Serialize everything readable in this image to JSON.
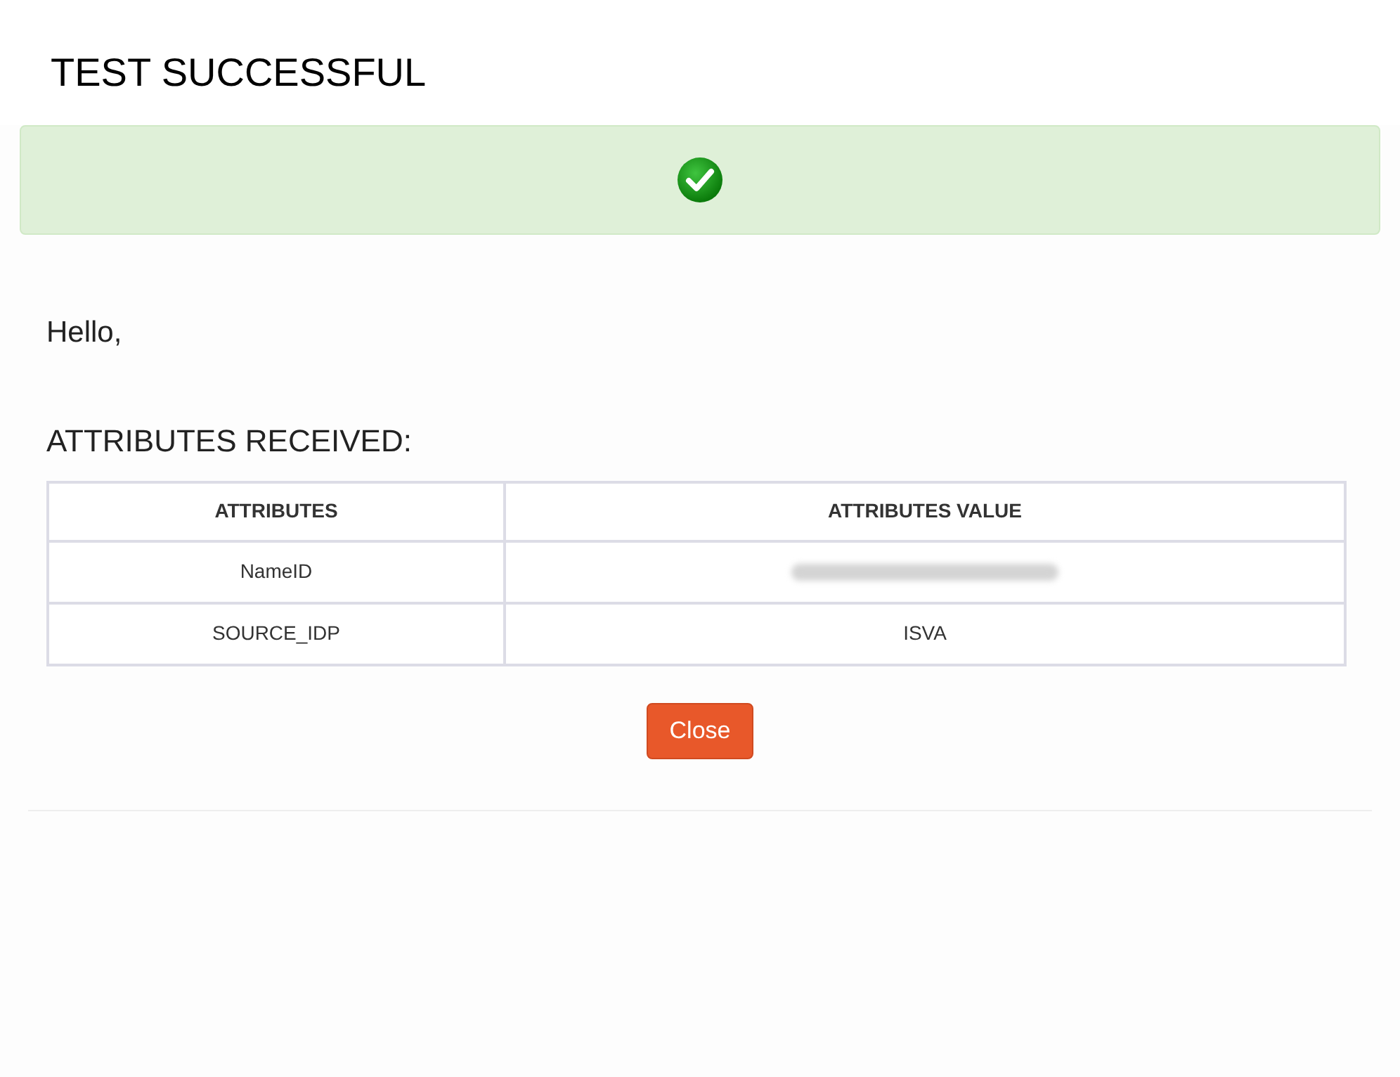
{
  "title": "TEST SUCCESSFUL",
  "banner": {
    "success": true
  },
  "greeting": "Hello,",
  "section_heading": "ATTRIBUTES RECEIVED:",
  "table": {
    "columns": [
      "ATTRIBUTES",
      "ATTRIBUTES VALUE"
    ],
    "rows": [
      {
        "name": "NameID",
        "kind": "redacted"
      },
      {
        "name": "SOURCE_IDP",
        "kind": "text",
        "value": "ISVA"
      }
    ]
  },
  "buttons": [
    "Close"
  ]
}
